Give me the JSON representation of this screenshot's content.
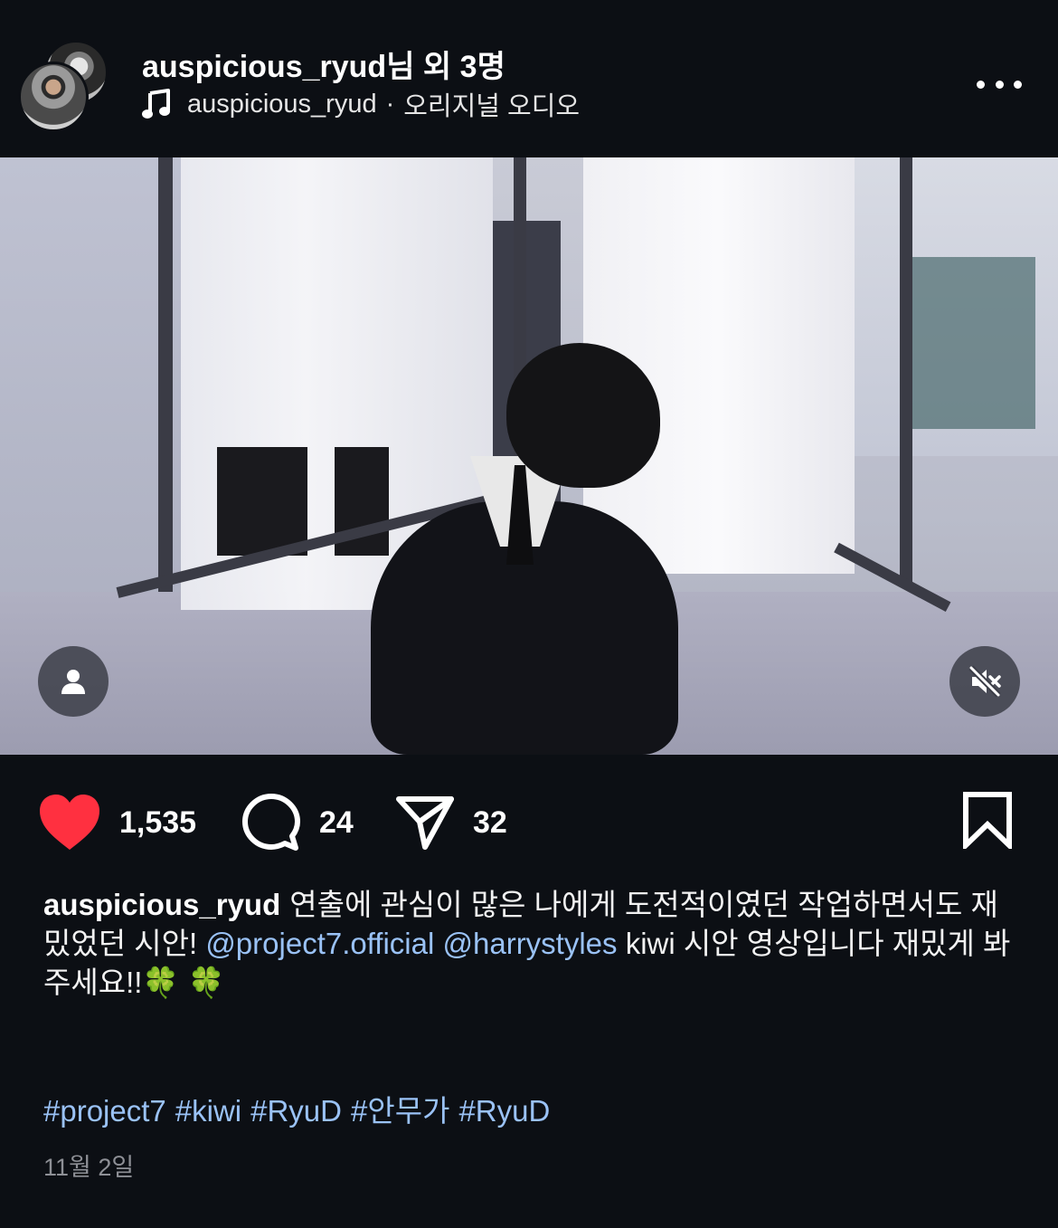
{
  "header": {
    "username": "auspicious_ryud",
    "collab_suffix": "님 외 3명",
    "audio_user": "auspicious_ryud",
    "audio_separator": "·",
    "audio_title": "오리지널 오디오",
    "more_icon": "more-horizontal-icon"
  },
  "video": {
    "tag_icon": "person-icon",
    "mute_icon": "speaker-muted-icon"
  },
  "actions": {
    "likes": "1,535",
    "comments": "24",
    "shares": "32",
    "like_color": "#ff3040"
  },
  "caption": {
    "username": "auspicious_ryud",
    "text_1": "연출에 관심이 많은 나에게 도전적이였던 작업하면서도 재밌었던 시안!",
    "mention_1": "@project7.official",
    "mention_2": "@harrystyles",
    "text_2": "kiwi 시안 영상입니다 재밌게 봐주세요!!🍀 🍀"
  },
  "hashtags": [
    "#project7",
    "#kiwi",
    "#RyuD",
    "#안무가",
    "#RyuD"
  ],
  "date": "11월 2일",
  "colors": {
    "background": "#0c0f14",
    "link": "#9ac2f6",
    "muted_text": "#8e9096"
  }
}
